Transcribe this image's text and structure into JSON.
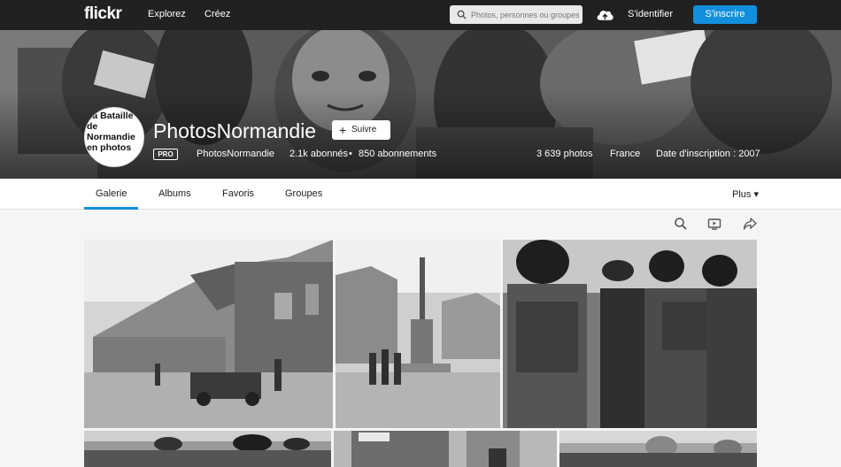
{
  "topnav": {
    "logo": "flickr",
    "explore": "Explorez",
    "create": "Créez",
    "search_placeholder": "Photos, personnes ou groupes",
    "signin": "S'identifier",
    "signup": "S'inscrire"
  },
  "profile": {
    "avatar_text": "La Bataille\nde\nNormandie\nen photos",
    "name": "PhotosNormandie",
    "follow": "Suivre",
    "pro": "PRO",
    "username": "PhotosNormandie",
    "followers": "2.1k abonnés",
    "separator": "•",
    "following": "850 abonnements",
    "photos": "3 639 photos",
    "country": "France",
    "joined": "Date d'inscription : 2007"
  },
  "tabs": {
    "gallery": "Galerie",
    "albums": "Albums",
    "favorites": "Favoris",
    "groups": "Groupes",
    "more": "Plus ▾"
  },
  "icons": [
    "search-icon",
    "slideshow-icon",
    "share-icon",
    "upload-cloud-icon"
  ],
  "colors": {
    "topbar": "#212124",
    "accent": "#128fdc"
  }
}
